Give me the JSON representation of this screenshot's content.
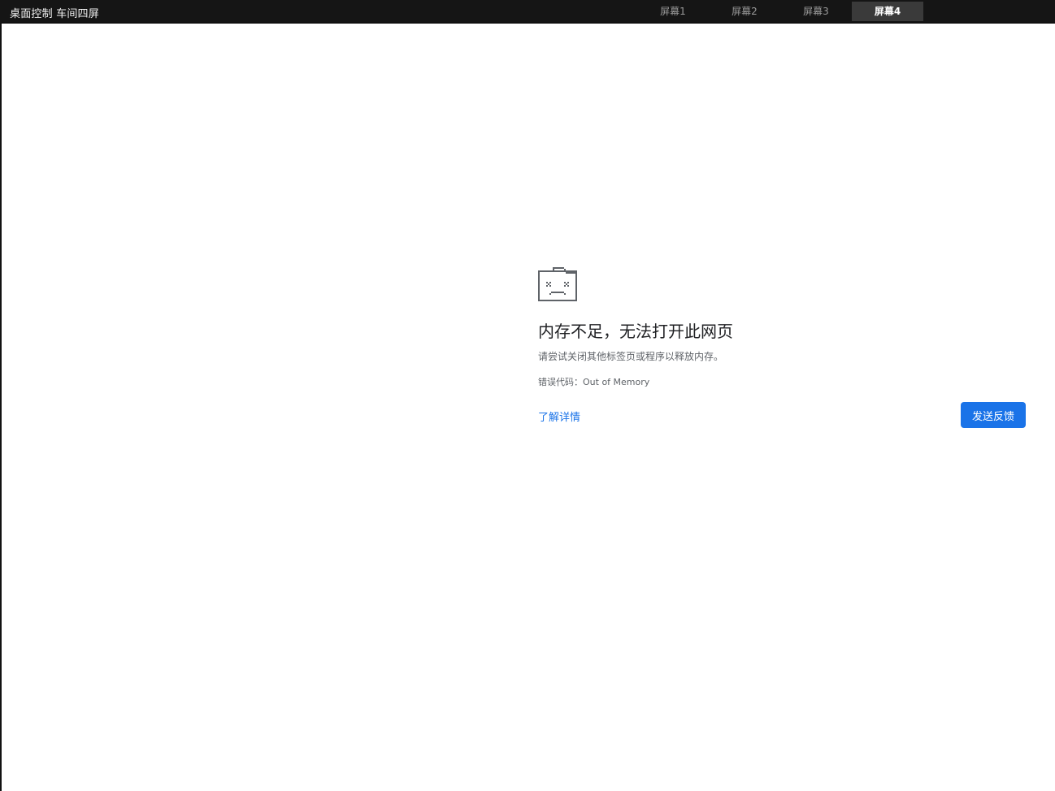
{
  "app": {
    "title": "桌面控制 车间四屏"
  },
  "screen_tabs": [
    {
      "label": "屏幕1",
      "active": false
    },
    {
      "label": "屏幕2",
      "active": false
    },
    {
      "label": "屏幕3",
      "active": false
    },
    {
      "label": "屏幕4",
      "active": true
    }
  ],
  "icons": {
    "dropdown": "chevron-down-icon",
    "error": "sad-folder-icon"
  },
  "error_page": {
    "title": "内存不足，无法打开此网页",
    "description": "请尝试关闭其他标签页或程序以释放内存。",
    "error_code": "错误代码：Out of Memory",
    "learn_more": "了解详情",
    "feedback_button": "发送反馈"
  },
  "colors": {
    "topbar": "#151515",
    "active_tab": "#3a3a3a",
    "link": "#1a73e8",
    "button": "#1a73e8"
  }
}
